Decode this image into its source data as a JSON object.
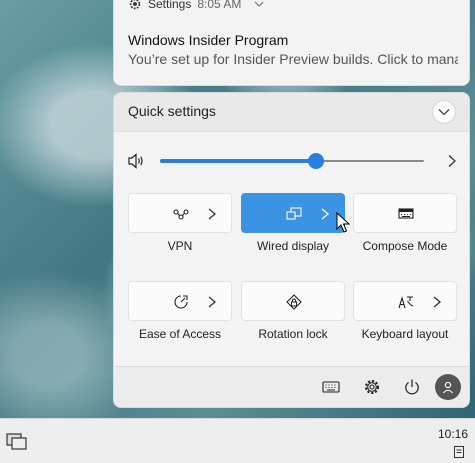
{
  "notification": {
    "app_name": "Settings",
    "time": "8:05 AM",
    "title": "Windows Insider Program",
    "body": "You’re set up for Insider Preview builds. Click to mana"
  },
  "quick_settings": {
    "title": "Quick settings",
    "volume": {
      "level_percent": 59
    },
    "tiles": [
      {
        "label": "VPN",
        "icon": "vpn-icon",
        "active": false,
        "has_chevron": true
      },
      {
        "label": "Wired display",
        "icon": "wired-display-icon",
        "active": true,
        "has_chevron": true
      },
      {
        "label": "Compose Mode",
        "icon": "keyboard-compose-icon",
        "active": false,
        "has_chevron": false
      },
      {
        "label": "Ease of Access",
        "icon": "ease-of-access-icon",
        "active": false,
        "has_chevron": true
      },
      {
        "label": "Rotation lock",
        "icon": "rotation-lock-icon",
        "active": false,
        "has_chevron": false
      },
      {
        "label": "Keyboard layout",
        "icon": "keyboard-layout-icon",
        "active": false,
        "has_chevron": true
      }
    ],
    "footer_icons": [
      "keyboard-icon",
      "settings-gear-icon",
      "power-icon",
      "user-avatar-icon"
    ]
  },
  "taskbar": {
    "time": "10:16"
  },
  "colors": {
    "accent": "#3b93e3",
    "slider": "#2a7de0",
    "panel": "#f3f3f3"
  }
}
